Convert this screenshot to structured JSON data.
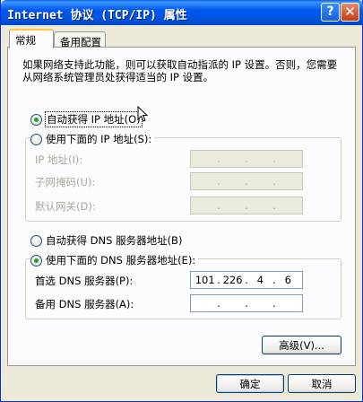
{
  "window": {
    "title": "Internet 协议 (TCP/IP) 属性",
    "help_glyph": "?",
    "close_glyph": "✕"
  },
  "tabs": [
    {
      "label": "常规",
      "active": true
    },
    {
      "label": "备用配置",
      "active": false
    }
  ],
  "description": "如果网络支持此功能，则可以获取自动指派的 IP 设置。否则，您需要从网络系统管理员处获得适当的 IP 设置。",
  "ip_section": {
    "auto_label": "自动获得 IP 地址(O)",
    "manual_label": "使用下面的 IP 地址(S):",
    "auto_selected": true,
    "fields": [
      {
        "label": "IP 地址(I):",
        "octets": [
          "",
          "",
          "",
          ""
        ]
      },
      {
        "label": "子网掩码(U):",
        "octets": [
          "",
          "",
          "",
          ""
        ]
      },
      {
        "label": "默认网关(D):",
        "octets": [
          "",
          "",
          "",
          ""
        ]
      }
    ]
  },
  "dns_section": {
    "auto_label": "自动获得 DNS 服务器地址(B)",
    "manual_label": "使用下面的 DNS 服务器地址(E):",
    "manual_selected": true,
    "fields": [
      {
        "label": "首选 DNS 服务器(P):",
        "octets": [
          "101",
          "226",
          "4",
          "6"
        ]
      },
      {
        "label": "备用 DNS 服务器(A):",
        "octets": [
          "",
          "",
          "",
          ""
        ]
      }
    ]
  },
  "buttons": {
    "advanced": "高级(V)...",
    "ok": "确定",
    "cancel": "取消"
  }
}
